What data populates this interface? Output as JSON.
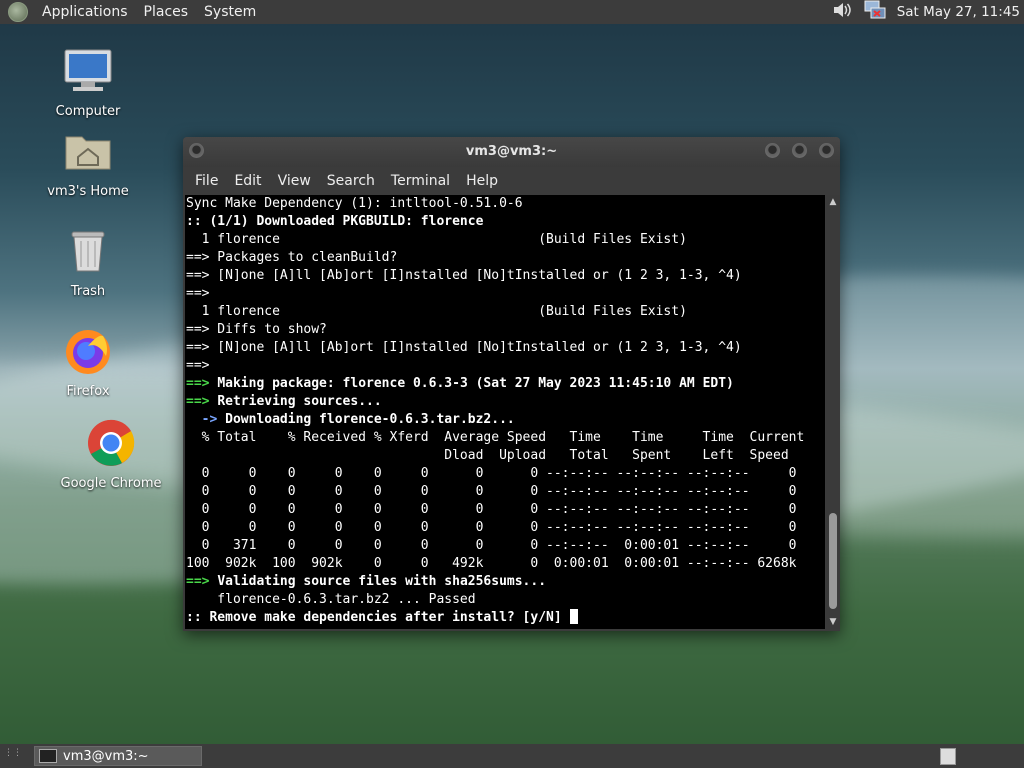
{
  "top_panel": {
    "menus": [
      "Applications",
      "Places",
      "System"
    ],
    "clock": "Sat May 27, 11:45",
    "icons": [
      "volume-icon",
      "network-icon"
    ]
  },
  "desktop_icons": [
    {
      "label": "Computer",
      "icon": "computer-icon"
    },
    {
      "label": "vm3's Home",
      "icon": "home-folder-icon"
    },
    {
      "label": "Trash",
      "icon": "trash-icon"
    },
    {
      "label": "Firefox",
      "icon": "firefox-icon"
    },
    {
      "label": "Google Chrome",
      "icon": "chrome-icon"
    }
  ],
  "window": {
    "title": "vm3@vm3:~",
    "menus": [
      "File",
      "Edit",
      "View",
      "Search",
      "Terminal",
      "Help"
    ]
  },
  "terminal": {
    "lines": [
      {
        "t": "Sync Make Dependency (1): intltool-0.51.0-6",
        "s": ""
      },
      {
        "t": ":: (1/1) Downloaded PKGBUILD: florence",
        "s": "b"
      },
      {
        "t": "  1 florence                                 (Build Files Exist)",
        "s": ""
      },
      {
        "t": "==> Packages to cleanBuild?",
        "s": ""
      },
      {
        "t": "==> [N]one [A]ll [Ab]ort [I]nstalled [No]tInstalled or (1 2 3, 1-3, ^4)",
        "s": ""
      },
      {
        "t": "==>",
        "s": ""
      },
      {
        "t": "  1 florence                                 (Build Files Exist)",
        "s": ""
      },
      {
        "t": "==> Diffs to show?",
        "s": ""
      },
      {
        "t": "==> [N]one [A]ll [Ab]ort [I]nstalled [No]tInstalled or (1 2 3, 1-3, ^4)",
        "s": ""
      },
      {
        "t": "==>",
        "s": ""
      },
      {
        "t": "Making package: florence 0.6.3-3 (Sat 27 May 2023 11:45:10 AM EDT)",
        "s": "g",
        "p": "==> "
      },
      {
        "t": "Retrieving sources...",
        "s": "g",
        "p": "==> "
      },
      {
        "t": "Downloading florence-0.6.3.tar.bz2...",
        "s": "bl",
        "p": "  -> "
      },
      {
        "t": "  % Total    % Received % Xferd  Average Speed   Time    Time     Time  Current",
        "s": ""
      },
      {
        "t": "                                 Dload  Upload   Total   Spent    Left  Speed",
        "s": ""
      },
      {
        "t": "  0     0    0     0    0     0      0      0 --:--:-- --:--:-- --:--:--     0",
        "s": ""
      },
      {
        "t": "  0     0    0     0    0     0      0      0 --:--:-- --:--:-- --:--:--     0",
        "s": ""
      },
      {
        "t": "  0     0    0     0    0     0      0      0 --:--:-- --:--:-- --:--:--     0",
        "s": ""
      },
      {
        "t": "  0     0    0     0    0     0      0      0 --:--:-- --:--:-- --:--:--     0",
        "s": ""
      },
      {
        "t": "  0   371    0     0    0     0      0      0 --:--:--  0:00:01 --:--:--     0",
        "s": ""
      },
      {
        "t": "100  902k  100  902k    0     0   492k      0  0:00:01  0:00:01 --:--:-- 6268k",
        "s": ""
      },
      {
        "t": "Validating source files with sha256sums...",
        "s": "g",
        "p": "==> "
      },
      {
        "t": "    florence-0.6.3.tar.bz2 ... Passed",
        "s": ""
      },
      {
        "t": ":: Remove make dependencies after install? [y/N] ",
        "s": "b",
        "cursor": true
      }
    ]
  },
  "taskbar": {
    "items": [
      {
        "label": "vm3@vm3:~"
      }
    ]
  }
}
